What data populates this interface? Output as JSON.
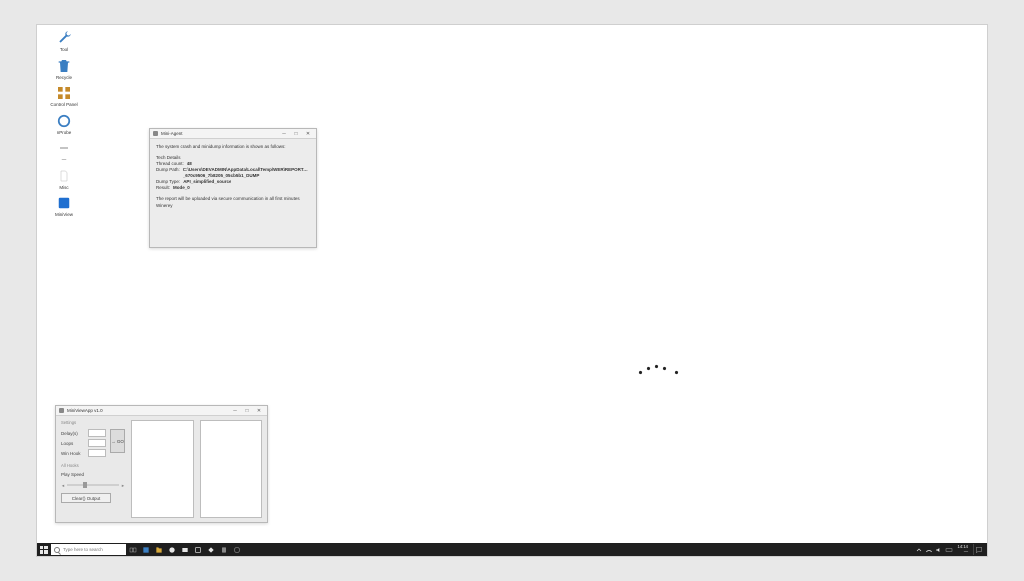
{
  "desktop_icons": [
    {
      "name": "Tool",
      "glyph": "wrench",
      "color": "#3a7ec2"
    },
    {
      "name": "Recycle",
      "glyph": "bin",
      "color": "#3a7ec2"
    },
    {
      "name": "Control Panel",
      "glyph": "grid",
      "color": "#c58a2a"
    },
    {
      "name": "nProbe",
      "glyph": "circle",
      "color": "#3a7ec2"
    },
    {
      "name": "—",
      "glyph": "dash",
      "color": "#888"
    },
    {
      "name": "Misc",
      "glyph": "doc",
      "color": "#e6e6e6"
    },
    {
      "name": "MiniView",
      "glyph": "blueapp",
      "color": "#1f6fd0"
    }
  ],
  "win_dump": {
    "title": "Mini-Agent",
    "intro": "The system crash and minidump information is shown as follows:",
    "section_label": "Tech Details",
    "fields": {
      "threads_label": "Thread count:",
      "threads_value": "48",
      "dump_path_label": "Dump Path:",
      "dump_path_value": "C:\\Users\\DEVADMIN\\AppData\\Local\\Temp\\WER\\REPORTARCHIVE\\…_670c9506_7b8205_05cb5b1_DUMP",
      "dump_type_label": "Dump Type:",
      "dump_type_value": "API_simplified_source",
      "result_label": "Result:",
      "result_value": "Mode_0"
    },
    "footer": "The report will be uploaded via secure communication in all first minutes Winerey"
  },
  "win_app": {
    "title": "MiniViewApp v1.0",
    "group_top": "Settings",
    "rows": {
      "delay_label": "Delay(s)",
      "delay_value": "",
      "loops_label": "Loops",
      "loops_value": "",
      "winhook_label": "Win Hook",
      "winhook_value": ""
    },
    "go_button": "→ GO",
    "group_bottom": "All Hooks",
    "slider_label": "Play Speed",
    "output_button": "Clear() Output"
  },
  "taskbar": {
    "search_placeholder": "Type here to search",
    "clock": {
      "time": "14:14",
      "date": "—"
    }
  }
}
